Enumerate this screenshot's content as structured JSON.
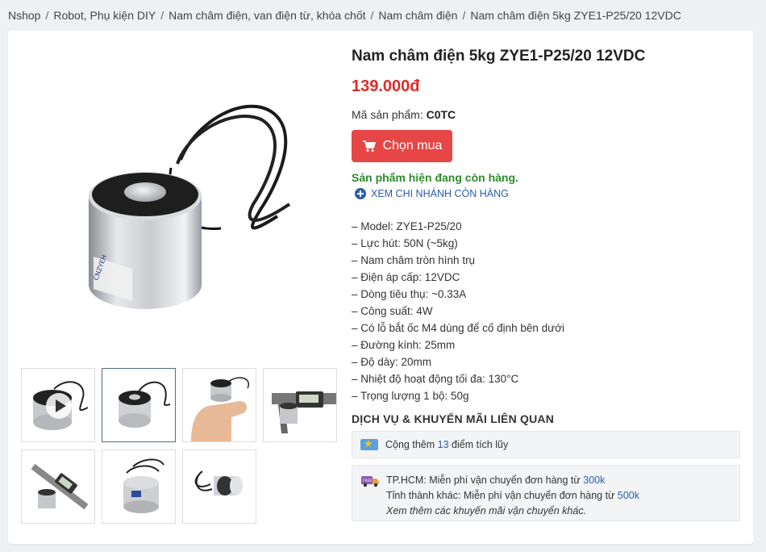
{
  "breadcrumb": {
    "items": [
      "Nshop",
      "Robot, Phụ kiện DIY",
      "Nam châm điện, van điện từ, khóa chốt",
      "Nam châm điện",
      "Nam châm điện 5kg ZYE1-P25/20 12VDC"
    ],
    "separator": "/"
  },
  "product": {
    "title": "Nam châm điện 5kg ZYE1-P25/20 12VDC",
    "price": "139.000đ",
    "sku_label": "Mã sản phẩm:",
    "sku_value": "C0TC",
    "buy_label": "Chọn mua",
    "stock_status": "Sản phẩm hiện đang còn hàng.",
    "branch_link": "XEM CHI NHÁNH CÒN HÀNG"
  },
  "specs": [
    "– Model: ZYE1-P25/20",
    "– Lực hút: 50N (~5kg)",
    "– Nam châm tròn hình trụ",
    "– Điện áp cấp: 12VDC",
    "– Dòng tiêu thụ: ~0.33A",
    "– Công suất: 4W",
    "– Có lỗ bắt ốc M4 dùng để cố định bên dưới",
    "– Đường kính: 25mm",
    "– Độ dày: 20mm",
    "– Nhiệt độ hoạt động tối đa: 130°C",
    "– Trọng lượng 1 bộ: 50g"
  ],
  "services": {
    "title": "DỊCH VỤ & KHUYẾN MÃI LIÊN QUAN",
    "points_prefix": "Cộng thêm",
    "points_value": "13",
    "points_suffix": "điểm tích lũy",
    "ship_hcm_prefix": "TP.HCM: Miễn phí vận chuyển đơn hàng từ",
    "ship_hcm_value": "300k",
    "ship_other_prefix": "Tỉnh thành khác: Miễn phí vận chuyển đơn hàng từ",
    "ship_other_value": "500k",
    "ship_note": "Xem thêm các khuyến mãi vận chuyển khác."
  },
  "colors": {
    "price": "#e02b27",
    "buy_button": "#e64646",
    "stock": "#2e8b2e",
    "link": "#2a5db0"
  }
}
